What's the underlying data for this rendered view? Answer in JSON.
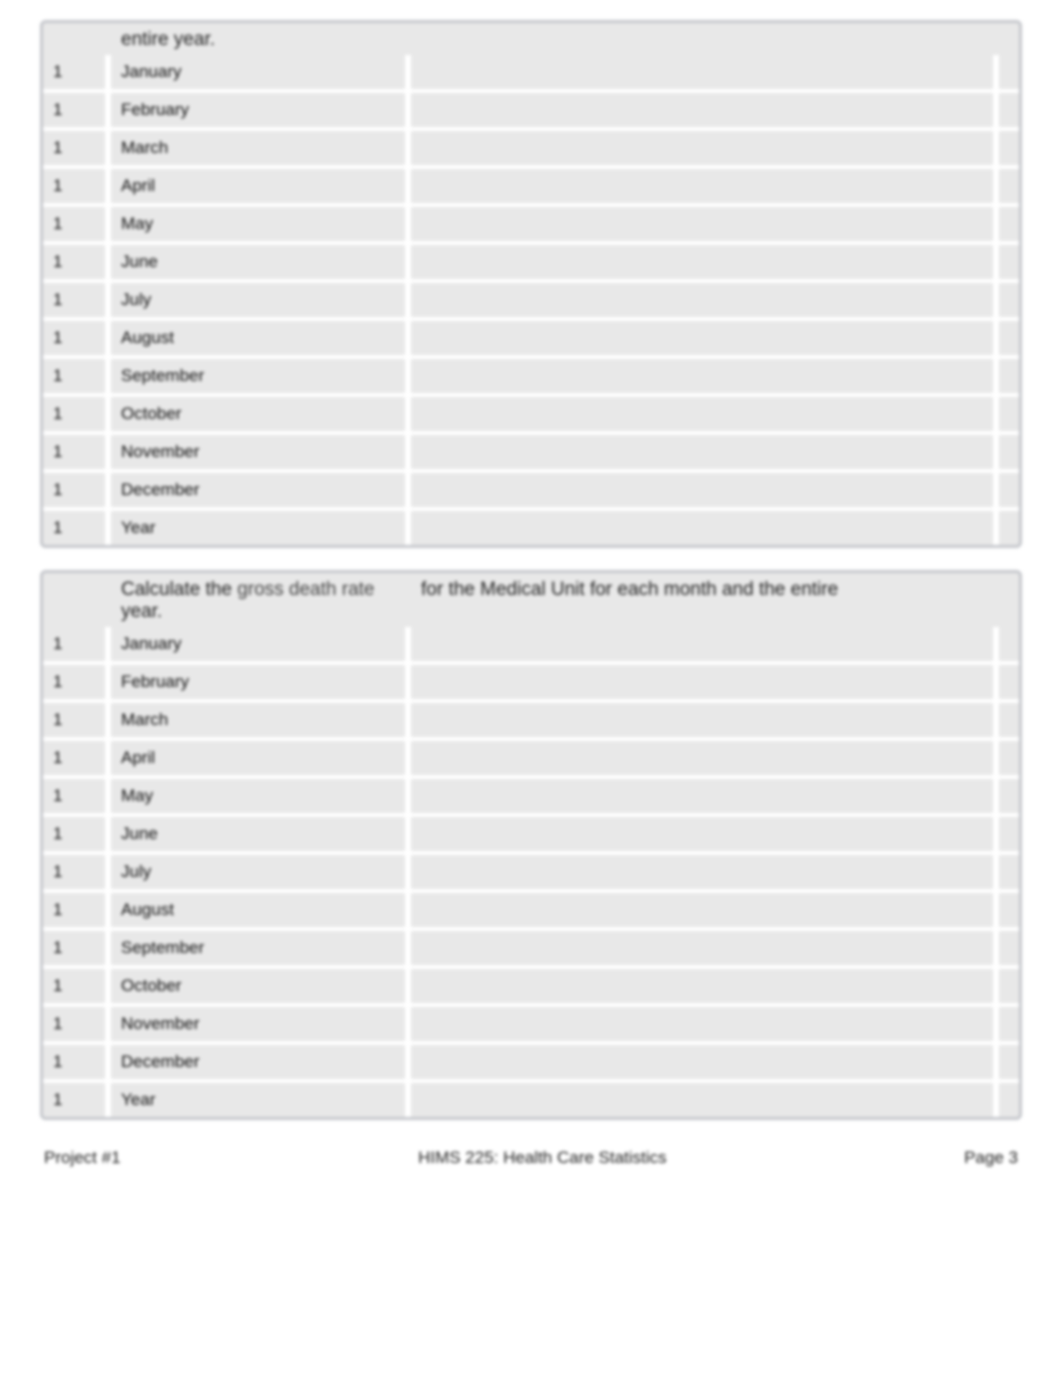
{
  "table1": {
    "header_text": "entire year.",
    "rows": [
      {
        "num": "1",
        "month": "January"
      },
      {
        "num": "1",
        "month": "February"
      },
      {
        "num": "1",
        "month": "March"
      },
      {
        "num": "1",
        "month": "April"
      },
      {
        "num": "1",
        "month": "May"
      },
      {
        "num": "1",
        "month": "June"
      },
      {
        "num": "1",
        "month": "July"
      },
      {
        "num": "1",
        "month": "August"
      },
      {
        "num": "1",
        "month": "September"
      },
      {
        "num": "1",
        "month": "October"
      },
      {
        "num": "1",
        "month": "November"
      },
      {
        "num": "1",
        "month": "December"
      },
      {
        "num": "1",
        "month": "Year"
      }
    ]
  },
  "table2": {
    "header_pre": "Calculate the ",
    "header_light": "gross death rate",
    "header_post_col2": "year.",
    "header_col3": "for the Medical Unit for each month and the entire",
    "rows": [
      {
        "num": "1",
        "month": "January"
      },
      {
        "num": "1",
        "month": "February"
      },
      {
        "num": "1",
        "month": "March"
      },
      {
        "num": "1",
        "month": "April"
      },
      {
        "num": "1",
        "month": "May"
      },
      {
        "num": "1",
        "month": "June"
      },
      {
        "num": "1",
        "month": "July"
      },
      {
        "num": "1",
        "month": "August"
      },
      {
        "num": "1",
        "month": "September"
      },
      {
        "num": "1",
        "month": "October"
      },
      {
        "num": "1",
        "month": "November"
      },
      {
        "num": "1",
        "month": "December"
      },
      {
        "num": "1",
        "month": "Year"
      }
    ]
  },
  "footer": {
    "left": "Project #1",
    "center": "HIMS 225:  Health Care Statistics",
    "right": "Page 3"
  }
}
